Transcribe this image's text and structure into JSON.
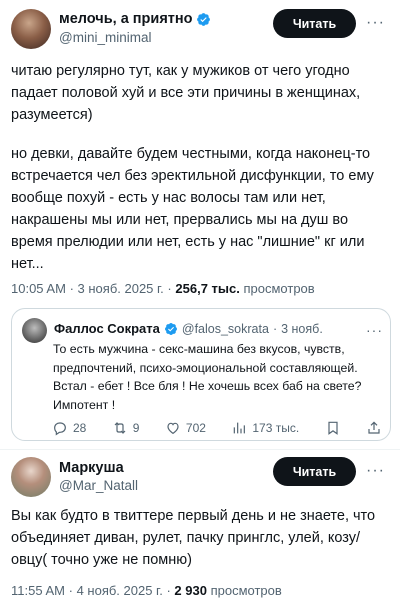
{
  "post1": {
    "author_name": "мелочь, а приятно",
    "handle": "@mini_minimal",
    "read_label": "Читать",
    "more": "···",
    "text_p1": "читаю регулярно тут, как у мужиков от чего угодно падает половой хуй и все эти причины в женщинах, разумеется)",
    "text_p2": "но девки, давайте будем честными, когда наконец-то встречается чел без эректильной дисфункции, то ему вообще похуй - есть у нас волосы там или нет, накрашены мы или нет, прервались мы на душ во время прелюдии или нет, есть у нас \"лишние\" кг или нет...",
    "time": "10:05 AM",
    "date": "3 нояб. 2025 г.",
    "views": "256,7 тыс.",
    "views_label": "просмотров",
    "dot": "·"
  },
  "quote": {
    "author_name": "Фаллос Сократа",
    "handle": "@falos_sokrata",
    "date": "3 нояб.",
    "more": "···",
    "text": "То есть мужчина - секс-машина без вкусов, чувств, предпочтений, психо-эмоциональной составляющей. Встал - ебет ! Все бля ! Не хочешь всех баб на свете? Импотент !",
    "replies": "28",
    "reposts": "9",
    "likes": "702",
    "views": "173 тыс.",
    "dot": "·"
  },
  "post2": {
    "author_name": "Маркуша",
    "handle": "@Mar_Natall",
    "read_label": "Читать",
    "more": "···",
    "text": "Вы как будто в твиттере первый день и не знаете, что объединяет диван, рулет, пачку принглс, улей, козу/ овцу( точно уже не помню)",
    "time": "11:55 AM",
    "date": "4 нояб. 2025 г.",
    "views": "2 930",
    "views_label": "просмотров",
    "dot": "·"
  },
  "colors": {
    "verified": "#1d9bf0",
    "text": "#0f1419",
    "muted": "#536471",
    "button": "#0f1419",
    "border": "#cfd9de"
  },
  "icons": [
    "verified-badge-icon",
    "more-icon",
    "reply-icon",
    "repost-icon",
    "like-icon",
    "views-icon",
    "bookmark-icon",
    "share-icon"
  ]
}
